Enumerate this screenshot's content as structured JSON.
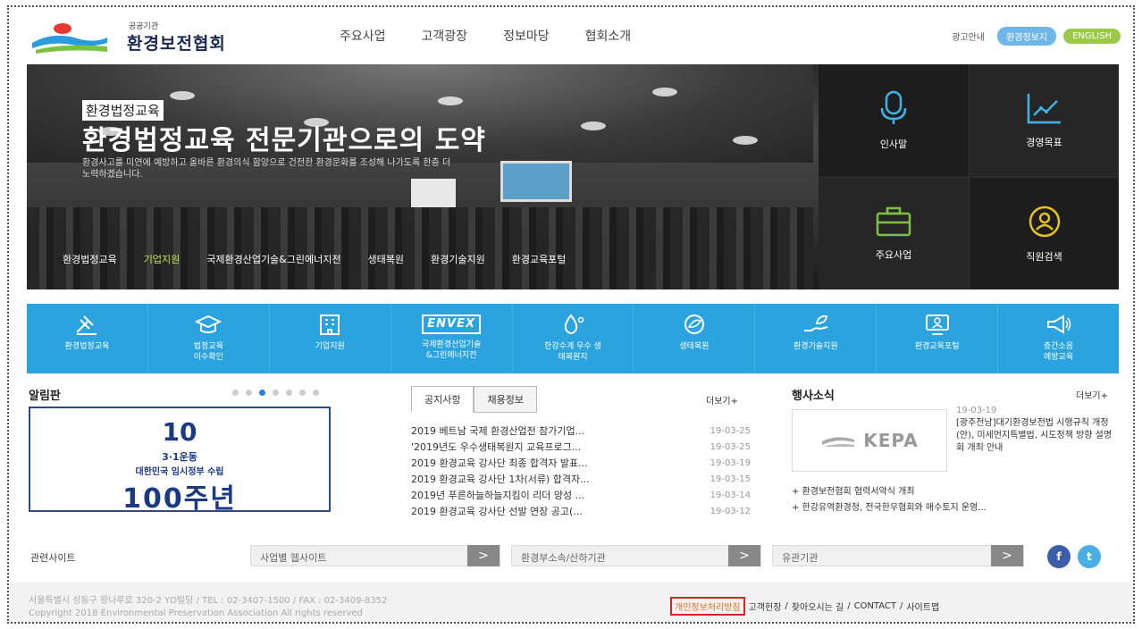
{
  "header": {
    "logo_sub": "공공기관",
    "logo_name": "환경보전협회",
    "nav": [
      "주요사업",
      "고객광장",
      "정보마당",
      "협회소개"
    ],
    "ad_link": "광고안내",
    "btn_env": "환경정보지",
    "btn_english": "ENGLISH"
  },
  "hero": {
    "tag": "환경법정교육",
    "title": "환경법정교육 전문기관으로의 도약",
    "desc": "환경사고를 미연에 예방하고 올바른 환경의식 함양으로 건전한 환경문화를 조성해 나가도록 한층 더 노력하겠습니다.",
    "tabs": [
      "환경법정교육",
      "기업지원",
      "국제환경산업기술&그린에너지전",
      "생태복원",
      "환경기술지원",
      "환경교육포털"
    ],
    "active_tab": "기업지원",
    "quick": [
      {
        "label": "인사말",
        "icon": "microphone-icon"
      },
      {
        "label": "경영목표",
        "icon": "chart-icon"
      },
      {
        "label": "주요사업",
        "icon": "briefcase-icon"
      },
      {
        "label": "직원검색",
        "icon": "person-search-icon"
      }
    ]
  },
  "icon_bar": [
    {
      "label": "환경법정교육",
      "icon": "gavel-icon"
    },
    {
      "label": "법정교육\n이수확인",
      "icon": "graduation-cap-icon"
    },
    {
      "label": "기업지원",
      "icon": "building-icon"
    },
    {
      "label": "국제환경산업기술\n&그린에너지전",
      "logo": "ENVEX"
    },
    {
      "label": "한강수계 우수 생\n태복원지",
      "icon": "water-drop-icon"
    },
    {
      "label": "생태복원",
      "icon": "leaf-globe-icon"
    },
    {
      "label": "환경기술지원",
      "icon": "hand-leaf-icon"
    },
    {
      "label": "환경교육포털",
      "icon": "monitor-person-icon"
    },
    {
      "label": "층간소음\n예방교육",
      "icon": "megaphone-icon"
    }
  ],
  "notice_board": {
    "title": "알림판",
    "banner": {
      "num": "10",
      "line1": "3·1운동",
      "line2": "대한민국 임시정부 수립",
      "big": "100주년"
    }
  },
  "news": {
    "tabs": [
      "공지사항",
      "채용정보"
    ],
    "more": "더보기+",
    "items": [
      {
        "title": "2019 베트남 국제 환경산업전 참가기업...",
        "date": "19-03-25"
      },
      {
        "title": "'2019년도 우수생태복원지 교육프로그...",
        "date": "19-03-25"
      },
      {
        "title": "2019 환경교육 강사단 최종 합격자 발표...",
        "date": "19-03-19"
      },
      {
        "title": "2019 환경교육 강사단 1차(서류) 합격자...",
        "date": "19-03-15"
      },
      {
        "title": "2019년 푸른하늘하늘지킴이 리더 양성 ...",
        "date": "19-03-14"
      },
      {
        "title": "2019 환경교육 강사단 선발 연장 공고(...",
        "date": "19-03-12"
      }
    ]
  },
  "events": {
    "title": "행사소식",
    "more": "더보기+",
    "logo_text": "KEPA",
    "date": "19-03-19",
    "text": "[광주전남]대기환경보전법 시행규칙 개정(안), 미세먼지특별법, 시도정책 방향 설명회 개최 안내",
    "list": [
      "+ 환경보전협회 협력서약식 개최",
      "+ 한강유역환경청, 전국한우협회와 매수토지 운영..."
    ]
  },
  "related": {
    "label": "관련사이트",
    "selects": [
      "사업별 웹사이트",
      "환경부소속/산하기관",
      "유관기관"
    ],
    "arrow": ">"
  },
  "footer": {
    "address": "서울특별시 성동구 왕나루로 320-2 YD빌딩 / TEL : 02-3407-1500 / FAX : 02-3409-8352",
    "copyright": "Copyright 2018 Environmental Preservation Association All rights reserved",
    "privacy": "개인정보처리방침",
    "links": [
      "고객헌장",
      "찾아오시는 길",
      "CONTACT",
      "사이트맵"
    ]
  },
  "colors": {
    "accent_blue": "#2ba3df",
    "accent_green": "#9bc94a",
    "highlight_red": "#e02020"
  }
}
